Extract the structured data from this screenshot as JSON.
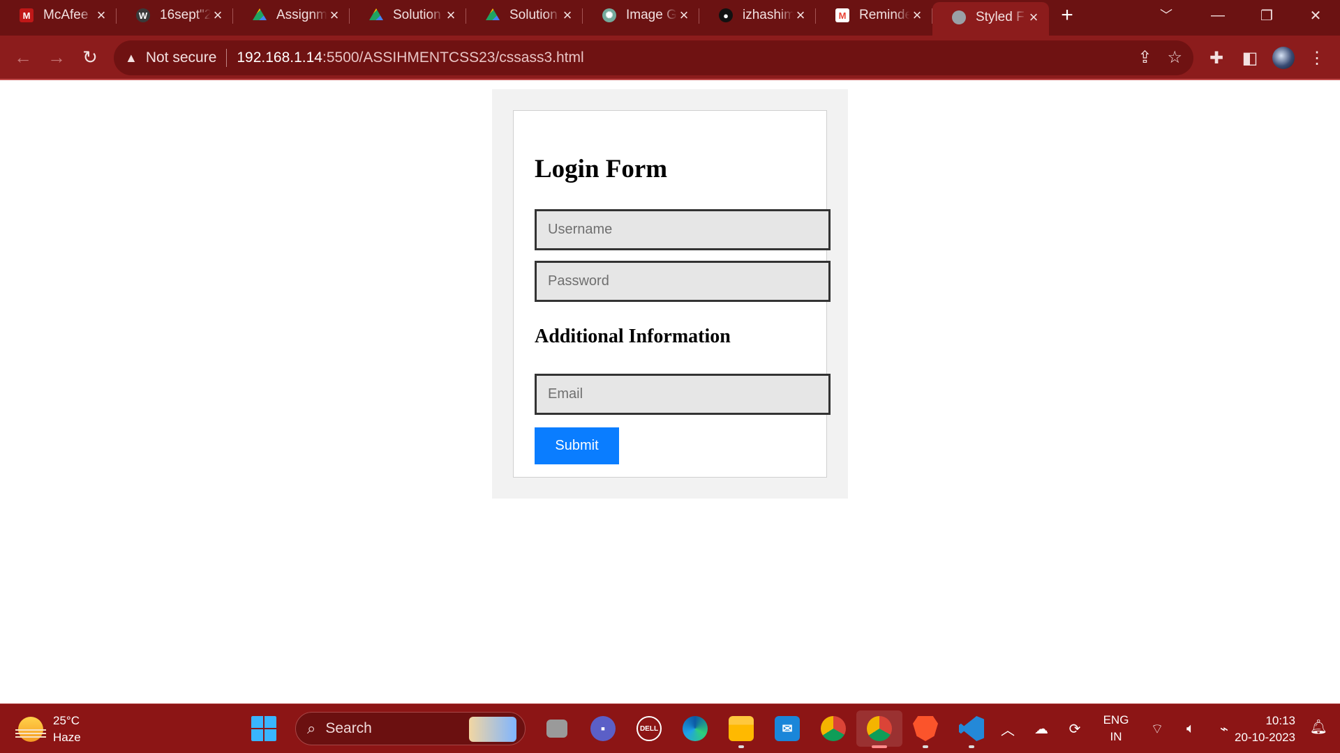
{
  "browser": {
    "tabs": [
      {
        "title": "McAfee",
        "icon": "mcafee-icon",
        "color": "#c01818"
      },
      {
        "title": "16sept\"2",
        "icon": "wordpress-icon",
        "color": "#3a3a3a"
      },
      {
        "title": "Assignm",
        "icon": "drive-icon",
        "color": "#1fa463"
      },
      {
        "title": "Solution",
        "icon": "drive-icon",
        "color": "#1fa463"
      },
      {
        "title": "Solution",
        "icon": "drive-icon",
        "color": "#1fa463"
      },
      {
        "title": "Image G",
        "icon": "chatgpt-icon",
        "color": "#74aa9c"
      },
      {
        "title": "izhashim",
        "icon": "github-icon",
        "color": "#111111"
      },
      {
        "title": "Reminde",
        "icon": "gmail-icon",
        "color": "#ea4335"
      },
      {
        "title": "Styled F",
        "icon": "globe-icon",
        "color": "#9aa0a6",
        "active": true
      }
    ],
    "address": {
      "security": "Not secure",
      "host": "192.168.1.14",
      "path": ":5500/ASSIHMENTCSS23/cssass3.html"
    }
  },
  "form": {
    "title": "Login Form",
    "username_placeholder": "Username",
    "password_placeholder": "Password",
    "section_title": "Additional Information",
    "email_placeholder": "Email",
    "submit_label": "Submit",
    "accent_color": "#0a7dff"
  },
  "taskbar": {
    "weather_temp": "25°C",
    "weather_desc": "Haze",
    "search_label": "Search",
    "lang_line1": "ENG",
    "lang_line2": "IN",
    "time": "10:13",
    "date": "20-10-2023"
  }
}
